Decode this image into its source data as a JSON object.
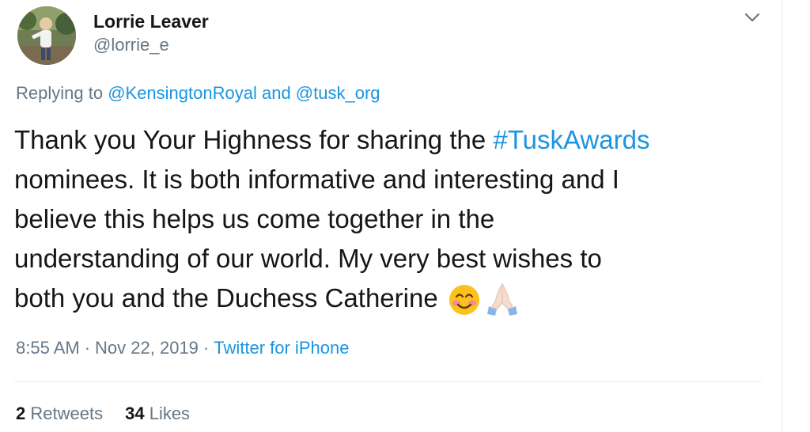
{
  "author": {
    "name": "Lorrie Leaver",
    "handle": "@lorrie_e"
  },
  "icons": {
    "menu": "chevron-down-icon",
    "emoji_1": "smiling-face-with-smiling-eyes-emoji",
    "emoji_2": "folded-hands-emoji"
  },
  "reply": {
    "prefix": "Replying to ",
    "mention_1": "@KensingtonRoyal",
    "conjunction": " and ",
    "mention_2": "@tusk_org"
  },
  "body": {
    "line1_text": "Thank you Your Highness for sharing the ",
    "hashtag": "#TuskAwards",
    "line2": " nominees. It is both informative and interesting and I",
    "line3": "believe this helps us come together in the",
    "line4": "understanding of our world. My very best wishes to",
    "line5": "both you and the Duchess Catherine"
  },
  "meta": {
    "time": "8:55 AM",
    "separator": "·",
    "date": "Nov 22, 2019",
    "source": "Twitter for iPhone"
  },
  "stats": {
    "retweets_count": "2",
    "retweets_label": "Retweets",
    "likes_count": "34",
    "likes_label": "Likes"
  },
  "colors": {
    "link": "#1b95e0",
    "secondary_text": "#657786",
    "primary_text": "#14171a",
    "divider": "#e6ecf0"
  }
}
